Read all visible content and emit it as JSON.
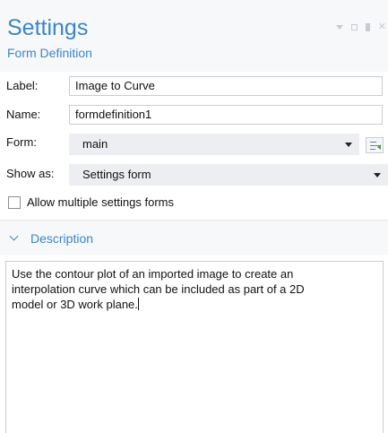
{
  "header": {
    "title": "Settings",
    "subtitle": "Form Definition"
  },
  "fields": {
    "label": {
      "caption": "Label:",
      "value": "Image to Curve"
    },
    "name": {
      "caption": "Name:",
      "value": "formdefinition1"
    },
    "form": {
      "caption": "Form:",
      "value": "main"
    },
    "show_as": {
      "caption": "Show as:",
      "value": "Settings form"
    }
  },
  "checkbox": {
    "label": "Allow multiple settings forms",
    "checked": false
  },
  "description": {
    "section_title": "Description",
    "text": "Use the contour plot of an imported image to create an\ninterpolation curve which can be included as part of a 2D\nmodel or 3D work plane."
  },
  "colors": {
    "accent": "#3a86c8",
    "header_bg": "#f7f8fa",
    "select_bg": "#eceef1"
  },
  "icons": {
    "window_controls": [
      "dropdown-icon",
      "maximize-icon",
      "pin-icon",
      "close-icon"
    ],
    "form_side_button": "edit-form-icon",
    "section_toggle": "chevron-down-icon"
  }
}
